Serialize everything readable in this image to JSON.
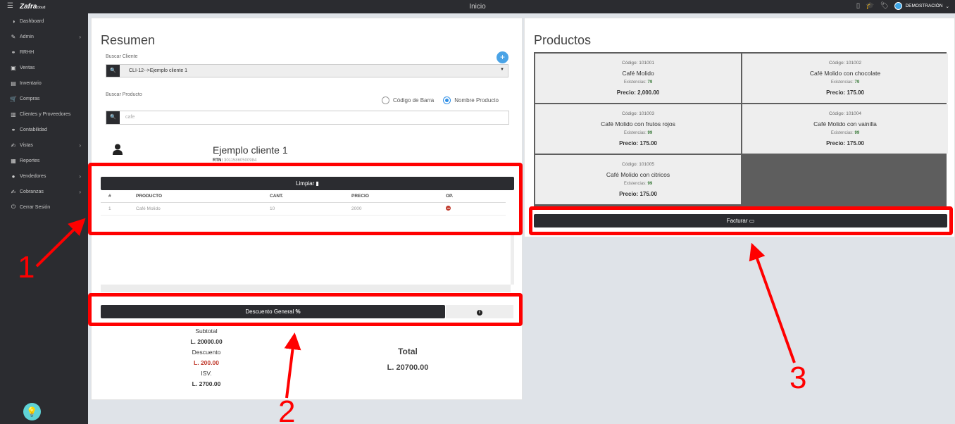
{
  "topbar": {
    "menu_icon": "hamburger-icon",
    "logo": "Zafra",
    "logo_suffix": "cloud",
    "title": "Inicio",
    "user_name": "DEMOSTRACIÓN"
  },
  "sidebar": {
    "items": [
      {
        "label": "Dashboard",
        "icon": "dashboard-icon",
        "chevron": false
      },
      {
        "label": "Admin",
        "icon": "wrench-icon",
        "chevron": true
      },
      {
        "label": "RRHH",
        "icon": "link-icon",
        "chevron": false
      },
      {
        "label": "Ventas",
        "icon": "money-icon",
        "chevron": false
      },
      {
        "label": "Inventario",
        "icon": "box-icon",
        "chevron": false
      },
      {
        "label": "Compras",
        "icon": "cart-icon",
        "chevron": false
      },
      {
        "label": "Clientes y Proveedores",
        "icon": "book-icon",
        "chevron": false
      },
      {
        "label": "Contabilidad",
        "icon": "link-icon",
        "chevron": false
      },
      {
        "label": "Vistas",
        "icon": "edit-icon",
        "chevron": true
      },
      {
        "label": "Reportes",
        "icon": "list-icon",
        "chevron": false
      },
      {
        "label": "Vendedores",
        "icon": "user-icon",
        "chevron": true
      },
      {
        "label": "Cobranzas",
        "icon": "edit-icon",
        "chevron": true
      },
      {
        "label": "Cerrar Sesión",
        "icon": "power-icon",
        "chevron": false
      }
    ]
  },
  "resumen": {
    "title": "Resumen",
    "buscar_cliente_label": "Buscar Cliente",
    "cliente_value": "CLI-12-->Ejemplo cliente 1",
    "buscar_producto_label": "Buscar Producto",
    "radio_codigo": "Código de Barra",
    "radio_nombre": "Nombre Producto",
    "producto_search_value": "cafe",
    "client_name": "Ejemplo cliente 1",
    "rtn_label": "RTN:",
    "rtn_value": "30115860500984",
    "limpiar_label": "Limpiar",
    "table": {
      "headers": [
        "#",
        "PRODUCTO",
        "CANT.",
        "PRECIO",
        "OP."
      ],
      "rows": [
        {
          "num": "1",
          "producto": "Café Molido",
          "cant": "10",
          "precio": "2000"
        }
      ]
    },
    "descuento_label": "Descuento General",
    "subtotal_label": "Subtotal",
    "subtotal_value": "L. 20000.00",
    "descuento_sum_label": "Descuento",
    "descuento_value": "L. 200.00",
    "isv_label": "ISV.",
    "isv_value": "L. 2700.00",
    "total_label": "Total",
    "total_value": "L. 20700.00"
  },
  "productos": {
    "title": "Productos",
    "facturar_label": "Facturar",
    "stock_label": "Existencias:",
    "items": [
      {
        "code": "Código: 101001",
        "name": "Café Molido",
        "stock": "79",
        "price": "Precio: 2,000.00"
      },
      {
        "code": "Código: 101002",
        "name": "Café Molido con chocolate",
        "stock": "79",
        "price": "Precio: 175.00"
      },
      {
        "code": "Código: 101003",
        "name": "Café Molido con frutos rojos",
        "stock": "99",
        "price": "Precio: 175.00"
      },
      {
        "code": "Código: 101004",
        "name": "Café Molido con vainilla",
        "stock": "99",
        "price": "Precio: 175.00"
      },
      {
        "code": "Código: 101005",
        "name": "Café Molido con citricos",
        "stock": "99",
        "price": "Precio: 175.00"
      }
    ]
  },
  "annotations": {
    "n1": "1",
    "n2": "2",
    "n3": "3",
    "color": "#ff0000"
  }
}
